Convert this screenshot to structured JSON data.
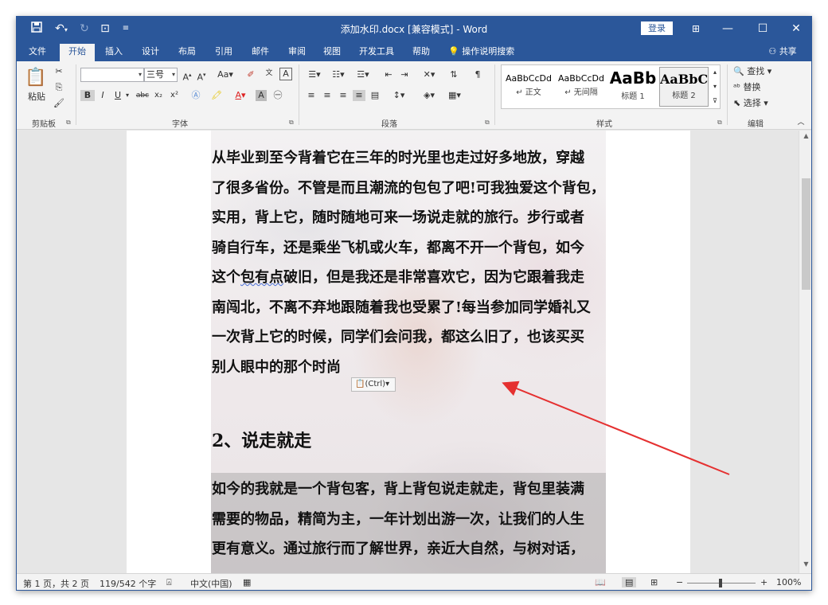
{
  "titlebar": {
    "title": "添加水印.docx [兼容模式] - Word",
    "login": "登录",
    "icons": {
      "save": "save-icon",
      "undo": "undo-icon",
      "redo": "redo-icon",
      "touch": "touch-mode-icon",
      "customize": "customize-qat-icon"
    },
    "min": "—",
    "max": "☐",
    "close": "✕",
    "ribbon_display": "⊞"
  },
  "tabs": {
    "file": "文件",
    "home": "开始",
    "insert": "插入",
    "design": "设计",
    "layout": "布局",
    "references": "引用",
    "mailings": "邮件",
    "review": "审阅",
    "view": "视图",
    "developer": "开发工具",
    "help": "帮助",
    "tell_me": "操作说明搜索",
    "share": "共享"
  },
  "ribbon": {
    "clipboard": {
      "paste": "粘贴",
      "group_label": "剪贴板"
    },
    "font": {
      "font_name": "",
      "font_size": "三号",
      "group_label": "字体",
      "bold": "B",
      "italic": "I",
      "underline": "U",
      "strike": "abc",
      "sub": "x₂",
      "sup": "x²",
      "aa": "Aa"
    },
    "paragraph": {
      "group_label": "段落"
    },
    "styles": {
      "group_label": "样式",
      "items": [
        {
          "sample": "AaBbCcDd",
          "name": "↵ 正文"
        },
        {
          "sample": "AaBbCcDd",
          "name": "↵ 无间隔"
        },
        {
          "sample": "AaBb",
          "name": "标题 1"
        },
        {
          "sample": "AaBbC",
          "name": "标题 2"
        }
      ]
    },
    "editing": {
      "find": "查找",
      "replace": "替换",
      "select": "选择",
      "group_label": "编辑"
    }
  },
  "document": {
    "para1": [
      "从毕业到至今背着它在三年的时光里也走过好多地放，穿越",
      "了很多省份。不管是而且潮流的包包了吧!可我独爱这个背包，",
      "实用，背上它，随时随地可来一场说走就的旅行。步行或者",
      "骑自行车，还是乘坐飞机或火车，都离不开一个背包，如今",
      "这个",
      "包有点",
      "破旧，但是我还是非常喜欢它，因为它跟着我走",
      "南闯北，不离不弃地跟随着我也受累了!每当参加同学婚礼又",
      "一次背上它的时候，同学们会问我，都这么旧了，也该买买",
      "别人眼中的那个时尚"
    ],
    "paste_options": "(Ctrl)",
    "heading": "2、说走就走",
    "para2": [
      "如今的我就是一个背包客，背上背包说走就走，背包里装满",
      "需要的物品，精简为主，一年计划出游一次，让我们的人生",
      "更有意义。通过旅行而了解世界，亲近大自然，与树对话，"
    ]
  },
  "statusbar": {
    "page": "第 1 页，共 2 页",
    "words": "119/542 个字",
    "language": "中文(中国)",
    "zoom": "100%",
    "zoom_minus": "−",
    "zoom_plus": "+"
  },
  "colors": {
    "accent": "#2b579a",
    "ribbon": "#f3f3f3",
    "arrow": "#e53030"
  }
}
